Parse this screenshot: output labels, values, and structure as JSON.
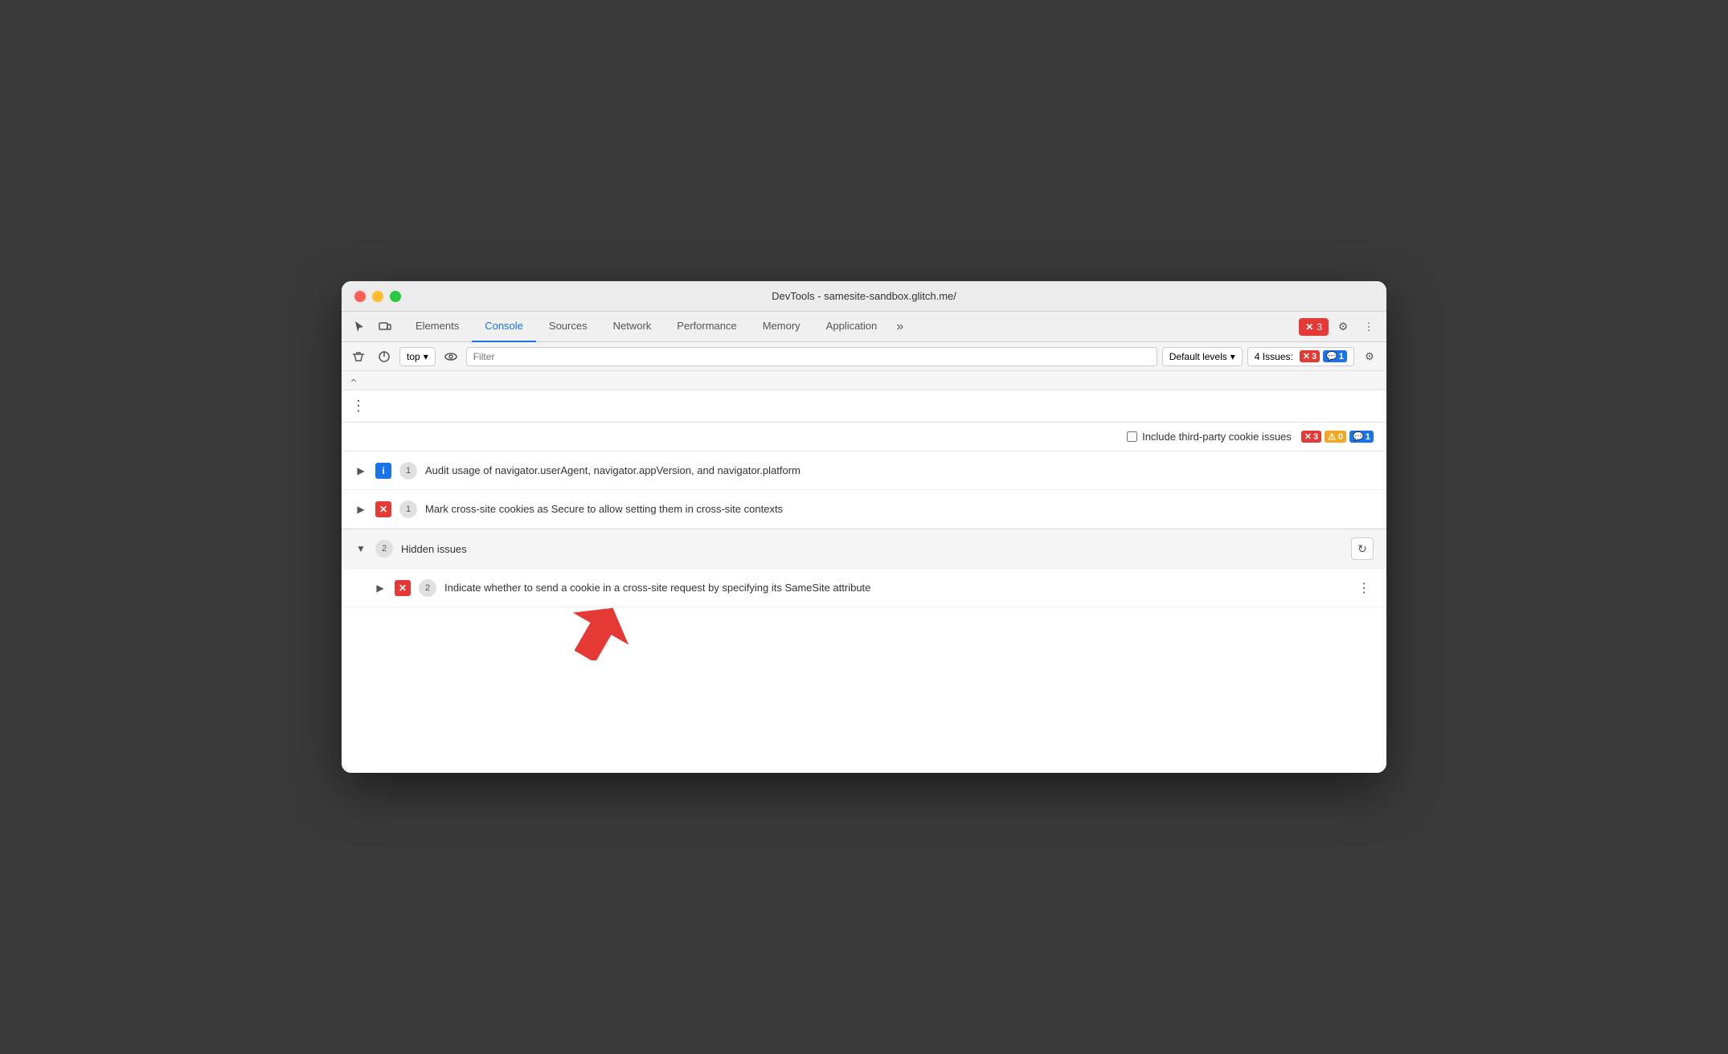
{
  "titlebar": {
    "title": "DevTools - samesite-sandbox.glitch.me/"
  },
  "tabs": {
    "items": [
      {
        "label": "Elements",
        "active": false
      },
      {
        "label": "Console",
        "active": true
      },
      {
        "label": "Sources",
        "active": false
      },
      {
        "label": "Network",
        "active": false
      },
      {
        "label": "Performance",
        "active": false
      },
      {
        "label": "Memory",
        "active": false
      },
      {
        "label": "Application",
        "active": false
      }
    ],
    "more_label": "»",
    "error_count": "3",
    "settings_label": "⚙",
    "more_options_label": "⋮"
  },
  "console_toolbar": {
    "top_label": "top",
    "filter_placeholder": "Filter",
    "default_levels_label": "Default levels",
    "issues_label": "4 Issues:",
    "error_count": "3",
    "info_count": "1"
  },
  "issues_panel": {
    "include_third_party_label": "Include third-party cookie issues",
    "error_count": "3",
    "warning_count": "0",
    "info_count": "1",
    "issues": [
      {
        "type": "info",
        "count": "1",
        "text": "Audit usage of navigator.userAgent, navigator.appVersion, and navigator.platform",
        "expanded": false
      },
      {
        "type": "error",
        "count": "1",
        "text": "Mark cross-site cookies as Secure to allow setting them in cross-site contexts",
        "expanded": false
      },
      {
        "type": "hidden",
        "count": "2",
        "label": "Hidden issues",
        "expanded": true,
        "sub_issues": [
          {
            "type": "error",
            "count": "2",
            "text": "Indicate whether to send a cookie in a cross-site request by specifying its SameSite attribute"
          }
        ]
      }
    ]
  }
}
